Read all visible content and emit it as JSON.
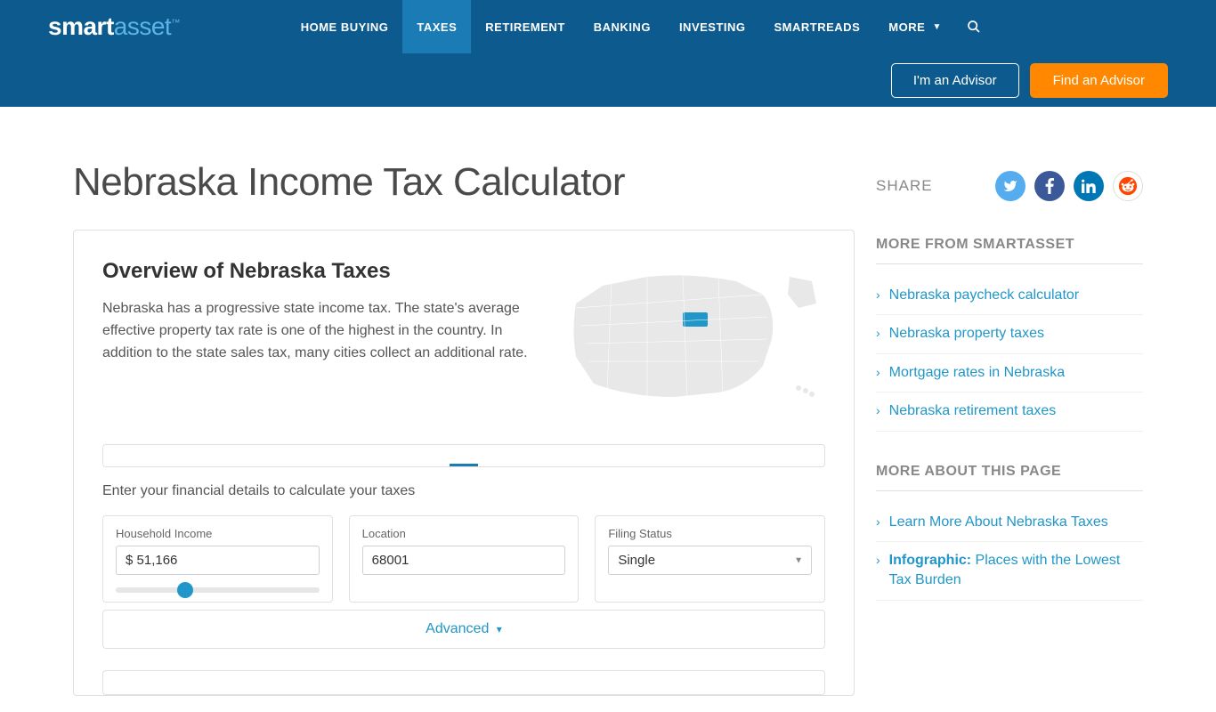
{
  "brand": {
    "part1": "smart",
    "part2": "asset",
    "tm": "™"
  },
  "nav": {
    "items": [
      "HOME BUYING",
      "TAXES",
      "RETIREMENT",
      "BANKING",
      "INVESTING",
      "SMARTREADS",
      "MORE"
    ],
    "active_index": 1
  },
  "header_buttons": {
    "advisor": "I'm an Advisor",
    "find": "Find an Advisor"
  },
  "page_title": "Nebraska Income Tax Calculator",
  "overview": {
    "title": "Overview of Nebraska Taxes",
    "description": "Nebraska has a progressive state income tax. The state's average effective property tax rate is one of the highest in the country. In addition to the state sales tax, many cities collect an additional rate."
  },
  "prompt": "Enter your financial details to calculate your taxes",
  "inputs": {
    "income": {
      "label": "Household Income",
      "value": "$ 51,166"
    },
    "location": {
      "label": "Location",
      "value": "68001"
    },
    "filing": {
      "label": "Filing Status",
      "value": "Single"
    }
  },
  "advanced_label": "Advanced",
  "share": {
    "label": "SHARE"
  },
  "sidebar": {
    "more_from": {
      "title": "MORE FROM SMARTASSET",
      "links": [
        "Nebraska paycheck calculator",
        "Nebraska property taxes",
        "Mortgage rates in Nebraska",
        "Nebraska retirement taxes"
      ]
    },
    "more_about": {
      "title": "MORE ABOUT THIS PAGE",
      "links": [
        {
          "bold": "",
          "text": "Learn More About Nebraska Taxes"
        },
        {
          "bold": "Infographic:",
          "text": " Places with the Lowest Tax Burden"
        }
      ]
    }
  }
}
